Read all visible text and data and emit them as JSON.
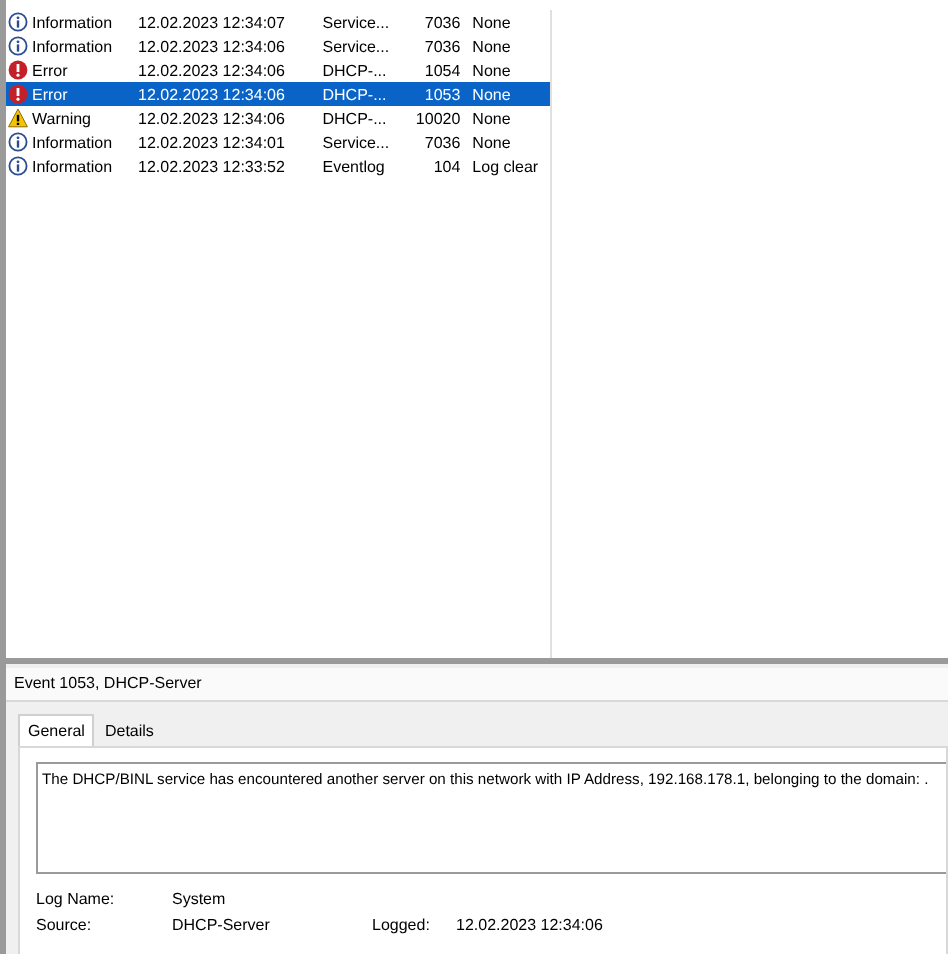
{
  "events": [
    {
      "kind": "information",
      "level_text": "Information",
      "date": "12.02.2023 12:34:07",
      "source": "Service...",
      "event_id": "7036",
      "task": "None",
      "selected": false
    },
    {
      "kind": "information",
      "level_text": "Information",
      "date": "12.02.2023 12:34:06",
      "source": "Service...",
      "event_id": "7036",
      "task": "None",
      "selected": false
    },
    {
      "kind": "error",
      "level_text": "Error",
      "date": "12.02.2023 12:34:06",
      "source": "DHCP-...",
      "event_id": "1054",
      "task": "None",
      "selected": false
    },
    {
      "kind": "error",
      "level_text": "Error",
      "date": "12.02.2023 12:34:06",
      "source": "DHCP-...",
      "event_id": "1053",
      "task": "None",
      "selected": true
    },
    {
      "kind": "warning",
      "level_text": "Warning",
      "date": "12.02.2023 12:34:06",
      "source": "DHCP-...",
      "event_id": "10020",
      "task": "None",
      "selected": false
    },
    {
      "kind": "information",
      "level_text": "Information",
      "date": "12.02.2023 12:34:01",
      "source": "Service...",
      "event_id": "7036",
      "task": "None",
      "selected": false
    },
    {
      "kind": "information",
      "level_text": "Information",
      "date": "12.02.2023 12:33:52",
      "source": "Eventlog",
      "event_id": "104",
      "task": "Log clear",
      "selected": false
    }
  ],
  "detail": {
    "title": "Event 1053, DHCP-Server",
    "tabs": [
      {
        "label": "General",
        "selected": true
      },
      {
        "label": "Details",
        "selected": false
      }
    ],
    "message": "The DHCP/BINL service has encountered another server on this network with IP Address, 192.168.178.1, belonging to the domain: .",
    "fields": [
      {
        "label": "Log Name:",
        "value": "System"
      },
      {
        "label": "Source:",
        "value": "DHCP-Server",
        "label_2": "Logged:",
        "value_2": "12.02.2023 12:34:06"
      }
    ]
  }
}
